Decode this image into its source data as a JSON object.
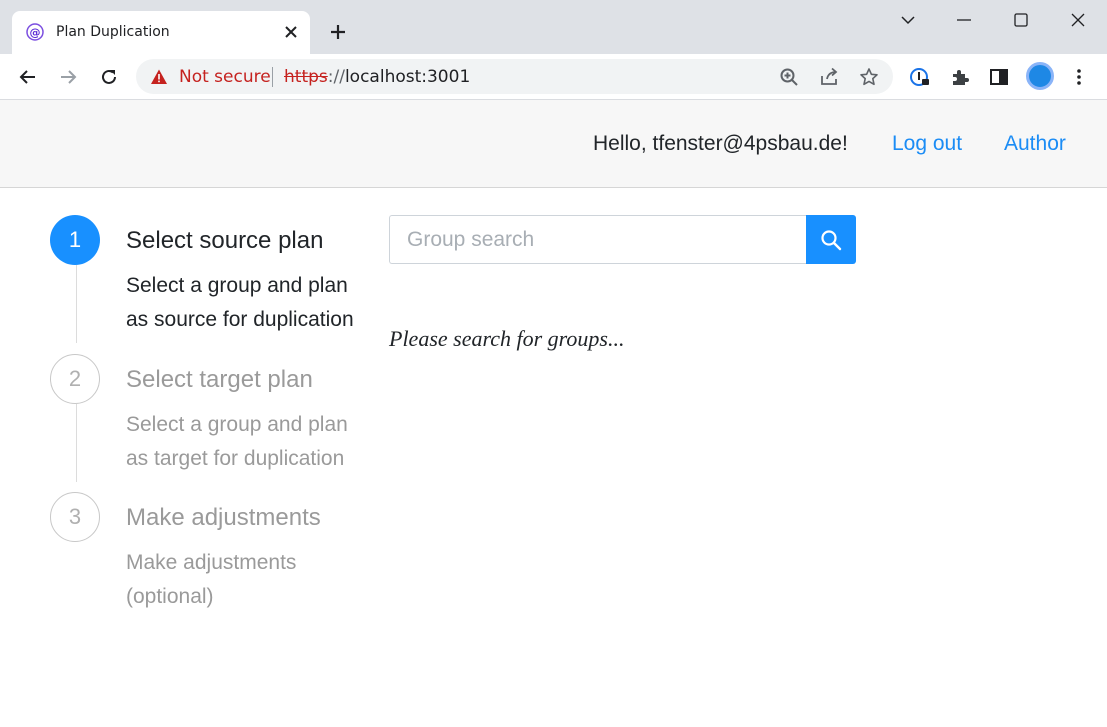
{
  "browser": {
    "tab_title": "Plan Duplication",
    "security_label": "Not secure",
    "url_protocol": "https",
    "url_separator": "://",
    "url_host": "localhost:3001"
  },
  "header": {
    "greeting": "Hello, tfenster@4psbau.de!",
    "logout_label": "Log out",
    "author_label": "Author"
  },
  "steps": [
    {
      "number": "1",
      "title": "Select source plan",
      "desc_line1": "Select a group and plan",
      "desc_line2": "as source for duplication",
      "state": "active"
    },
    {
      "number": "2",
      "title": "Select target plan",
      "desc_line1": "Select a group and plan",
      "desc_line2": "as target for duplication",
      "state": "inactive"
    },
    {
      "number": "3",
      "title": "Make adjustments",
      "desc_line1": "Make adjustments",
      "desc_line2": "(optional)",
      "state": "inactive"
    }
  ],
  "search": {
    "placeholder": "Group search",
    "value": "",
    "hint": "Please search for groups..."
  },
  "colors": {
    "accent": "#1890ff",
    "link": "#1b8cf5",
    "insecure": "#c5221f"
  }
}
